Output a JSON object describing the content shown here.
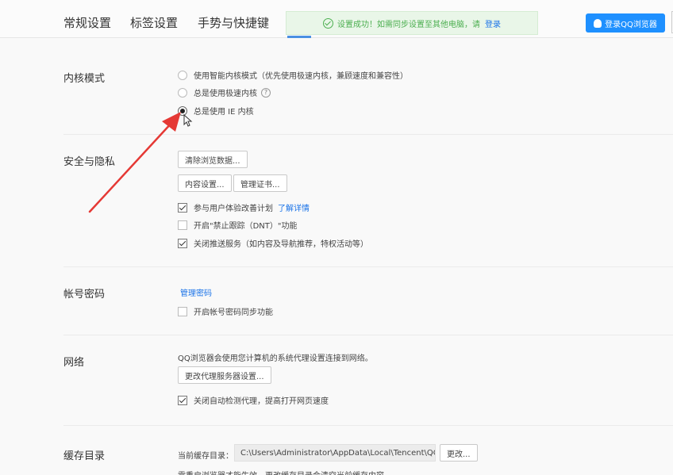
{
  "header": {
    "tabs": [
      {
        "label": "常规设置"
      },
      {
        "label": "标签设置"
      },
      {
        "label": "手势与快捷键"
      }
    ],
    "toast": {
      "message": "设置成功！如需同步设置至其他电脑，请",
      "link": "登录"
    },
    "login_button": "登录QQ浏览器"
  },
  "kernel": {
    "title": "内核模式",
    "options": [
      {
        "label": "使用智能内核模式（优先使用极速内核，兼顾速度和兼容性）",
        "checked": false
      },
      {
        "label": "总是使用极速内核",
        "checked": false
      },
      {
        "label": "总是使用 IE 内核",
        "checked": true
      }
    ],
    "help": "?"
  },
  "security": {
    "title": "安全与隐私",
    "clear_button": "清除浏览数据...",
    "content_button": "内容设置...",
    "cert_button": "管理证书...",
    "options": [
      {
        "label": "参与用户体验改善计划",
        "checked": true
      },
      {
        "label": "开启\"禁止跟踪（DNT）\"功能",
        "checked": false
      },
      {
        "label": "关闭推送服务（如内容及导航推荐，特权活动等）",
        "checked": true
      }
    ],
    "learn_more": "了解详情"
  },
  "account": {
    "title": "帐号密码",
    "manage_link": "管理密码",
    "sync_option": "开启帐号密码同步功能"
  },
  "network": {
    "title": "网络",
    "description": "QQ浏览器会使用您计算机的系统代理设置连接到网络。",
    "proxy_button": "更改代理服务器设置...",
    "auto_detect": "关闭自动检测代理，提高打开网页速度"
  },
  "cache": {
    "title": "缓存目录",
    "label": "当前缓存目录：",
    "path": "C:\\Users\\Administrator\\AppData\\Local\\Tencent\\QQ",
    "change_button": "更改...",
    "note": "需重启浏览器才能生效，更改缓存目录会清空当前缓存内容"
  },
  "colors": {
    "accent": "#1a73e8",
    "toast_bg": "#e9f6e8",
    "toast_text": "#4caf50",
    "arrow": "#e53935"
  }
}
